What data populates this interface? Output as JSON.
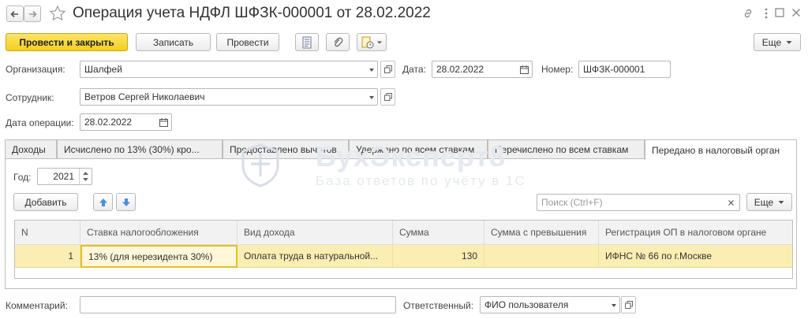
{
  "window": {
    "title": "Операция учета НДФЛ ШФЗК-000001 от 28.02.2022",
    "icons": [
      "back-arrow-icon",
      "forward-arrow-icon",
      "star-icon",
      "link-icon",
      "more-vert-icon",
      "maximize-icon",
      "close-icon"
    ]
  },
  "toolbar": {
    "post_close_label": "Провести и закрыть",
    "save_label": "Записать",
    "post_label": "Провести",
    "more_label": "Еще"
  },
  "form": {
    "organization_label": "Организация:",
    "organization_value": "Шалфей",
    "date_label": "Дата:",
    "date_value": "28.02.2022",
    "number_label": "Номер:",
    "number_value": "ШФЗК-000001",
    "employee_label": "Сотрудник:",
    "employee_value": "Ветров Сергей Николаевич",
    "op_date_label": "Дата операции:",
    "op_date_value": "28.02.2022"
  },
  "tabs": [
    {
      "label": "Доходы"
    },
    {
      "label": "Исчислено по 13% (30%) кро..."
    },
    {
      "label": "Предоставлено вычетов"
    },
    {
      "label": "Удержано по всем ставкам"
    },
    {
      "label": "Перечислено по всем ставкам"
    },
    {
      "label": "Передано в налоговый орган"
    }
  ],
  "panel": {
    "year_label": "Год:",
    "year_value": "2021",
    "add_label": "Добавить",
    "search_placeholder": "Поиск (Ctrl+F)",
    "more_label": "Еще"
  },
  "table": {
    "columns": [
      "N",
      "Ставка налогообложения",
      "Вид дохода",
      "Сумма",
      "Сумма с превышения",
      "Регистрация ОП в налоговом органе"
    ],
    "rows": [
      [
        "1",
        "13% (для нерезидента 30%)",
        "Оплата труда в натуральной...",
        "130",
        "",
        "ИФНС № 66 по г.Москве"
      ]
    ]
  },
  "footer": {
    "comment_label": "Комментарий:",
    "comment_value": "",
    "responsible_label": "Ответственный:",
    "responsible_value": "ФИО пользователя"
  },
  "watermark": {
    "title": "БухЭксперт8",
    "subtitle": "База ответов по учёту в 1С"
  },
  "colors": {
    "primary_button": "#f4cf1e",
    "selected_row": "#fbeeb3",
    "arrow_blue": "#4a90d9"
  }
}
